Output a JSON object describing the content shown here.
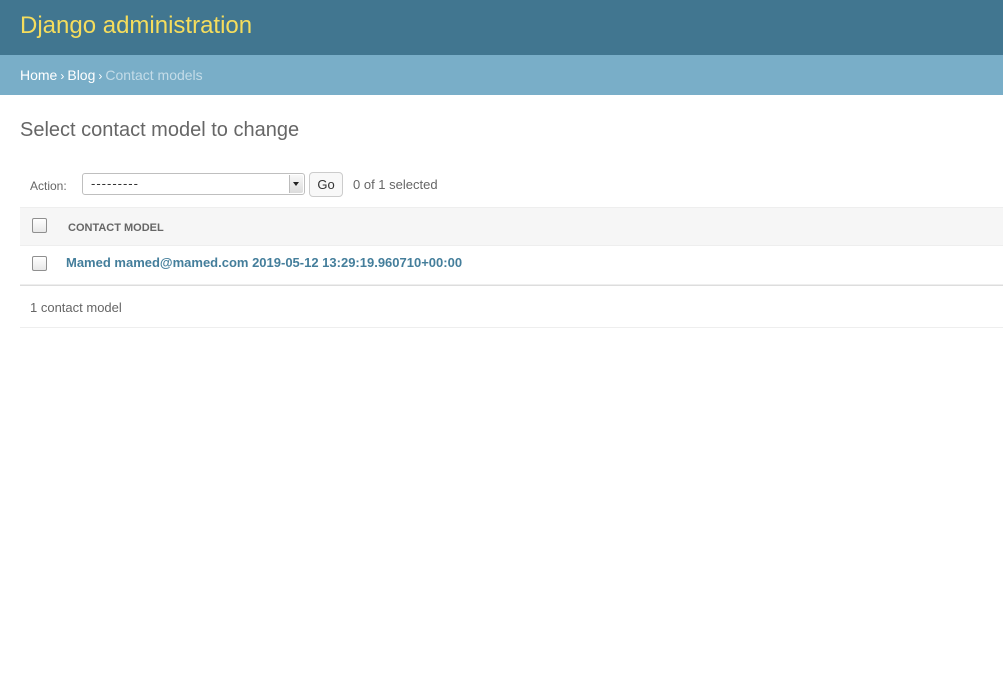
{
  "header": {
    "site_title": "Django administration"
  },
  "breadcrumbs": {
    "home": "Home",
    "separator": "›",
    "app": "Blog",
    "current": "Contact models"
  },
  "page": {
    "title": "Select contact model to change"
  },
  "actions": {
    "label": "Action:",
    "selected_value": "---------",
    "go_label": "Go",
    "selected_count": "0 of 1 selected"
  },
  "table": {
    "columns": [
      "CONTACT MODEL"
    ],
    "rows": [
      {
        "label": "Mamed mamed@mamed.com 2019-05-12 13:29:19.960710+00:00",
        "checked": false
      }
    ]
  },
  "paginator": {
    "text": "1 contact model"
  },
  "colors": {
    "header_bg": "#417690",
    "title_color": "#f5dd5d",
    "breadcrumbs_bg": "#79aec8",
    "link_color": "#447e9b"
  }
}
